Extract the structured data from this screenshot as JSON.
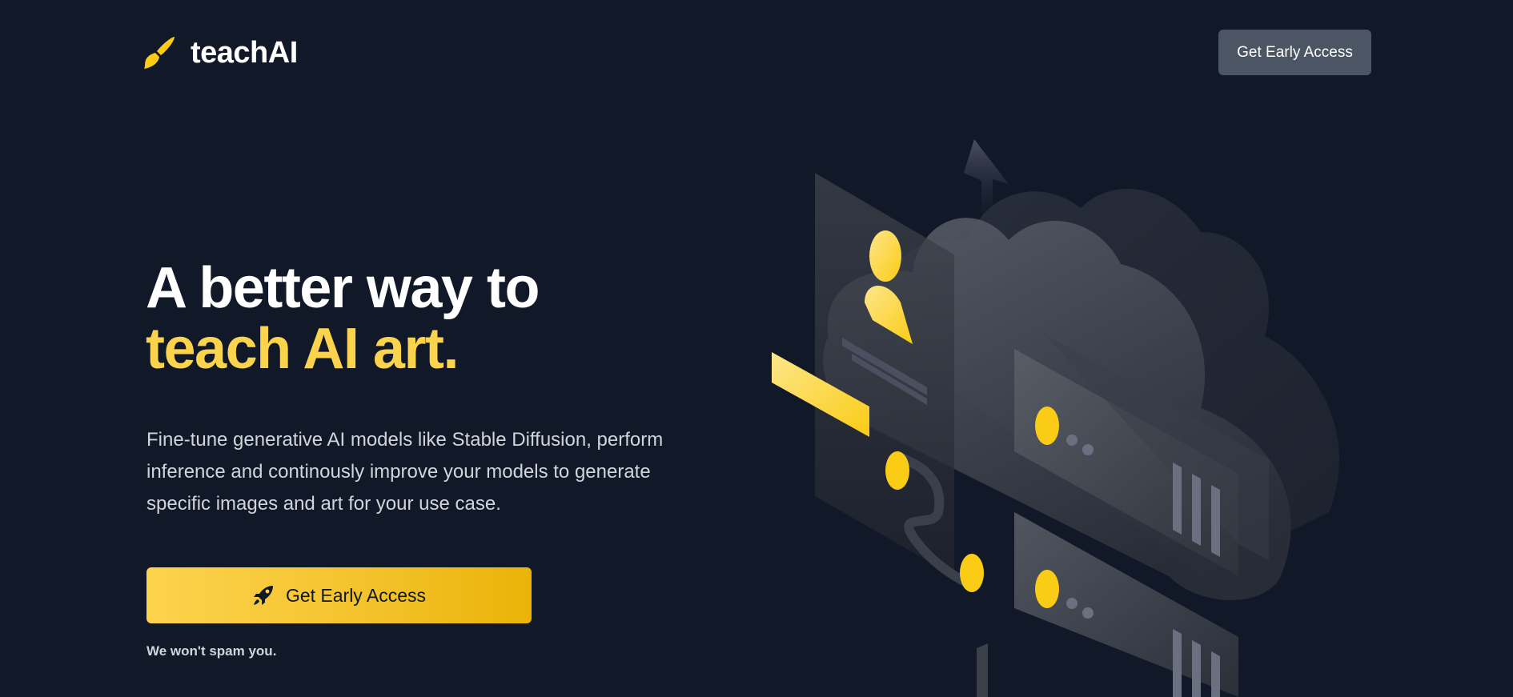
{
  "header": {
    "brand": "teachAI",
    "logo_icon": "paintbrush-icon",
    "cta_label": "Get Early Access"
  },
  "hero": {
    "title_line1": "A better way to",
    "title_line2": "teach AI art.",
    "description": "Fine-tune generative AI models like Stable Diffusion, perform inference and continously improve your models to generate specific images and art for your use case.",
    "cta_label": "Get Early Access",
    "cta_icon": "rocket-icon",
    "note": "We won't spam you."
  },
  "illustration": {
    "icon": "cloud-server-illustration"
  },
  "colors": {
    "background": "#111827",
    "accent": "#fcd34d",
    "accent_dark": "#eab308",
    "nav_button": "#4b5563",
    "text_muted": "#d1d5db"
  }
}
